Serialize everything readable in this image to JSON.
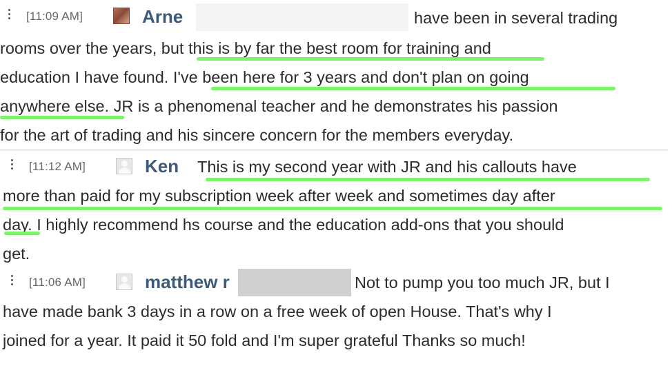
{
  "messages": [
    {
      "timestamp": "[11:09 AM]",
      "username": "Arne",
      "avatar": "user-photo",
      "lines": [
        "have been in several trading",
        "rooms over the years, but this is by far the best room for training and",
        "education I have found. I've been here for 3 years and don't plan on going",
        "anywhere else. JR is a phenomenal teacher and he demonstrates his passion",
        "for the art of trading and his sincere concern for the members everyday."
      ]
    },
    {
      "timestamp": "[11:12 AM]",
      "username": "Ken",
      "avatar": "default-avatar",
      "lines": [
        "This is my second year with JR and his callouts have",
        "more than paid for my subscription week after week and sometimes day after",
        "day. I highly recommend hs course and the education add-ons that you should",
        "get."
      ]
    },
    {
      "timestamp": "[11:06 AM]",
      "username": "matthew r",
      "avatar": "default-avatar",
      "lines": [
        "Not to pump you too much JR, but I",
        "have made bank 3 days in a row on a free week of open House. That's why I",
        "joined for a year. It paid it 50 fold and I'm super grateful Thanks so much!"
      ]
    }
  ],
  "highlight_color": "#7df26b",
  "name_color": "#3e5a7a"
}
